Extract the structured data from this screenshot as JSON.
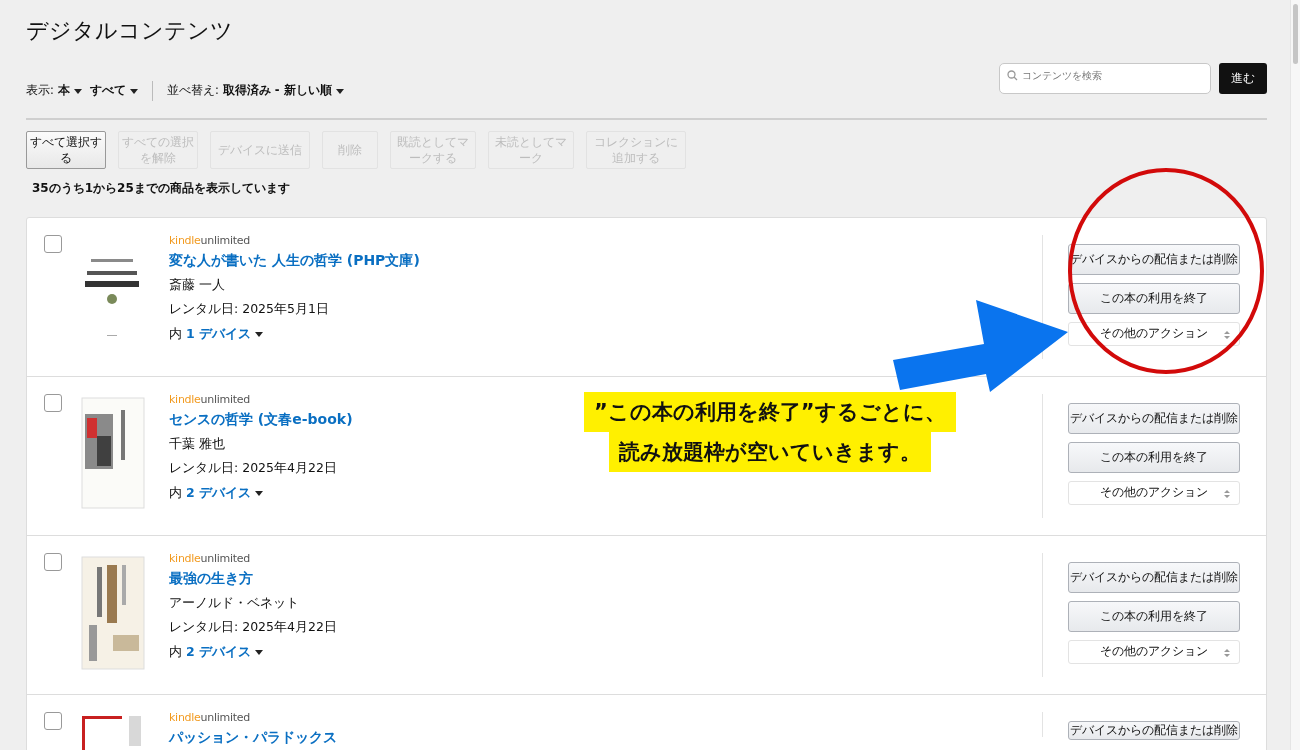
{
  "page_title": "デジタルコンテンツ",
  "filters": {
    "show_label": "表示:",
    "show_type": "本",
    "show_scope": "すべて",
    "sort_label": "並べ替え:",
    "sort_value": "取得済み - 新しい順"
  },
  "search": {
    "placeholder": "コンテンツを検索",
    "button": "進む"
  },
  "toolbar": [
    {
      "label": "すべて選択する",
      "disabled": false
    },
    {
      "label": "すべての選択を解除",
      "disabled": true
    },
    {
      "label": "デバイスに送信",
      "disabled": true
    },
    {
      "label": "削除",
      "disabled": true
    },
    {
      "label": "既読としてマークする",
      "disabled": true
    },
    {
      "label": "未読としてマーク",
      "disabled": true
    },
    {
      "label": "コレクションに追加する",
      "disabled": true
    }
  ],
  "count_text": "35のうち1から25までの商品を表示しています",
  "items": [
    {
      "checked": false,
      "brand": [
        "kindle",
        "unlimited"
      ],
      "title": "変な人が書いた 人生の哲学 (PHP文庫)",
      "author": "斎藤 一人",
      "date": "レンタル日: 2025年5月1日",
      "devices_prefix": "内",
      "devices_link": "1 デバイス",
      "actions": [
        "デバイスからの配信または削除",
        "この本の利用を終了"
      ],
      "more": "その他のアクション"
    },
    {
      "checked": false,
      "brand": [
        "kindle",
        "unlimited"
      ],
      "title": "センスの哲学 (文春e-book)",
      "author": "千葉 雅也",
      "date": "レンタル日: 2025年4月22日",
      "devices_prefix": "内",
      "devices_link": "2 デバイス",
      "actions": [
        "デバイスからの配信または削除",
        "この本の利用を終了"
      ],
      "more": "その他のアクション"
    },
    {
      "checked": false,
      "brand": [
        "kindle",
        "unlimited"
      ],
      "title": "最強の生き方",
      "author": "アーノルド・ベネット",
      "date": "レンタル日: 2025年4月22日",
      "devices_prefix": "内",
      "devices_link": "2 デバイス",
      "actions": [
        "デバイスからの配信または削除",
        "この本の利用を終了"
      ],
      "more": "その他のアクション"
    },
    {
      "checked": false,
      "brand": [
        "kindle",
        "unlimited"
      ],
      "title": "パッション・パラドックス",
      "actions": [
        "デバイスからの配信または削除"
      ]
    }
  ],
  "annotation": {
    "lines": [
      "”この本の利用を終了”するごとに、",
      "読み放題枠が空いていきます。"
    ]
  }
}
